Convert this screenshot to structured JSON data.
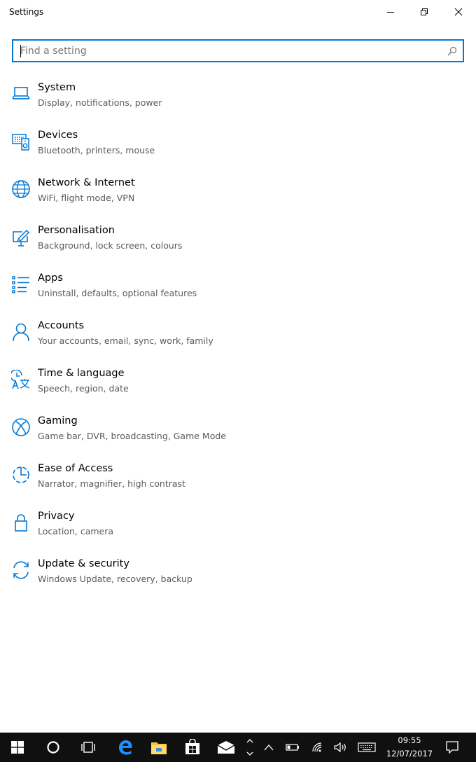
{
  "window": {
    "title": "Settings",
    "minimize_icon": "minimize-icon",
    "restore_icon": "restore-icon",
    "close_icon": "close-icon"
  },
  "search": {
    "placeholder": "Find a setting",
    "value": "",
    "icon": "search-icon"
  },
  "accent_color": "#0078d7",
  "categories": [
    {
      "title": "System",
      "subtitle": "Display, notifications, power",
      "icon": "laptop-icon"
    },
    {
      "title": "Devices",
      "subtitle": "Bluetooth, printers, mouse",
      "icon": "devices-icon"
    },
    {
      "title": "Network & Internet",
      "subtitle": "WiFi, flight mode, VPN",
      "icon": "globe-icon"
    },
    {
      "title": "Personalisation",
      "subtitle": "Background, lock screen, colours",
      "icon": "paint-icon"
    },
    {
      "title": "Apps",
      "subtitle": "Uninstall, defaults, optional features",
      "icon": "apps-list-icon"
    },
    {
      "title": "Accounts",
      "subtitle": "Your accounts, email, sync, work, family",
      "icon": "person-icon"
    },
    {
      "title": "Time & language",
      "subtitle": "Speech, region, date",
      "icon": "time-language-icon"
    },
    {
      "title": "Gaming",
      "subtitle": "Game bar, DVR, broadcasting, Game Mode",
      "icon": "xbox-icon"
    },
    {
      "title": "Ease of Access",
      "subtitle": "Narrator, magnifier, high contrast",
      "icon": "ease-of-access-icon"
    },
    {
      "title": "Privacy",
      "subtitle": "Location, camera",
      "icon": "lock-icon"
    },
    {
      "title": "Update & security",
      "subtitle": "Windows Update, recovery, backup",
      "icon": "sync-icon"
    }
  ],
  "taskbar": {
    "time": "09:55",
    "date": "12/07/2017",
    "icons": [
      "windows-start-icon",
      "cortana-icon",
      "task-view-icon",
      "edge-icon",
      "file-explorer-icon",
      "store-icon",
      "mail-icon"
    ]
  }
}
